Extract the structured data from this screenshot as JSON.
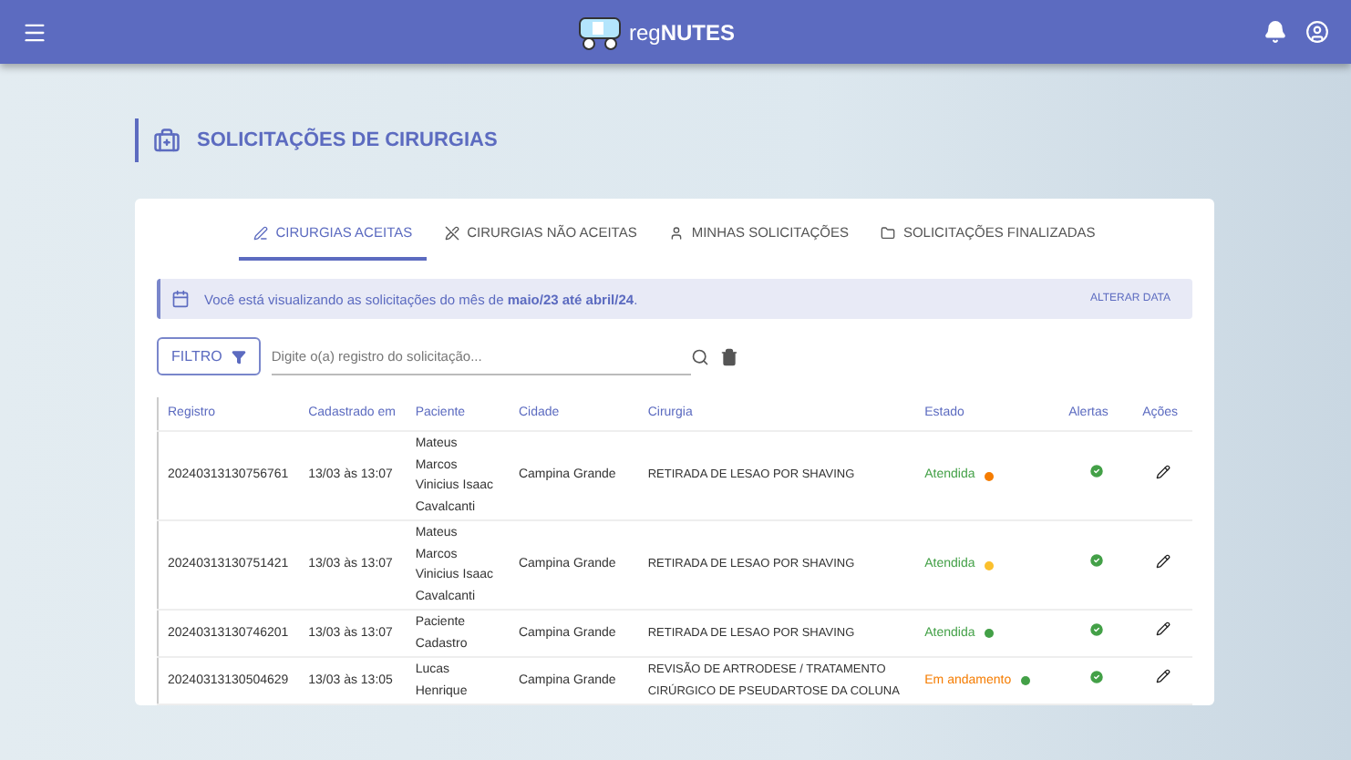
{
  "header": {
    "logo_text": "reg",
    "logo_bold": "NUTES"
  },
  "page_title": "SOLICITAÇÕES DE CIRURGIAS",
  "tabs": [
    {
      "label": "CIRURGIAS ACEITAS",
      "selected": true
    },
    {
      "label": "CIRURGIAS NÃO ACEITAS",
      "selected": false
    },
    {
      "label": "MINHAS SOLICITAÇÕES",
      "selected": false
    },
    {
      "label": "SOLICITAÇÕES FINALIZADAS",
      "selected": false
    }
  ],
  "banner": {
    "text": "Você está visualizando as solicitações do mês de **maio/23 até abril/24**.",
    "action": "ALTERAR DATA"
  },
  "filter": {
    "button": "FILTRO",
    "placeholder": "Digite o(a) registro do solicitação..."
  },
  "table": {
    "columns": [
      "Registro",
      "Cadastrado em",
      "Paciente",
      "Cidade",
      "Cirurgia",
      "Estado",
      "Alertas",
      "Ações"
    ],
    "rows": [
      {
        "registro": "20240313130756761",
        "cadastrado": "13/03 às 13:07",
        "paciente": "Mateus Marcos Vinicius Isaac Cavalcanti",
        "cidade": "Campina Grande",
        "cirurgia": "RETIRADA DE LESAO POR SHAVING",
        "estado": "Atendida",
        "kind": "done",
        "color": "#f57c00"
      },
      {
        "registro": "20240313130751421",
        "cadastrado": "13/03 às 13:07",
        "paciente": "Mateus Marcos Vinicius Isaac Cavalcanti",
        "cidade": "Campina Grande",
        "cirurgia": "RETIRADA DE LESAO POR SHAVING",
        "estado": "Atendida",
        "kind": "done",
        "color": "#fbc02d"
      },
      {
        "registro": "20240313130746201",
        "cadastrado": "13/03 às 13:07",
        "paciente": "Paciente Cadastro",
        "cidade": "Campina Grande",
        "cirurgia": "RETIRADA DE LESAO POR SHAVING",
        "estado": "Atendida",
        "kind": "done",
        "color": "#43a047"
      },
      {
        "registro": "20240313130504629",
        "cadastrado": "13/03 às 13:05",
        "paciente": "Lucas Henrique",
        "cidade": "Campina Grande",
        "cirurgia": "REVISÃO DE ARTRODESE / TRATAMENTO CIRÚRGICO DE PSEUDARTOSE DA COLUNA",
        "estado": "Em andamento",
        "kind": "progress",
        "color": "#43a047"
      }
    ]
  }
}
